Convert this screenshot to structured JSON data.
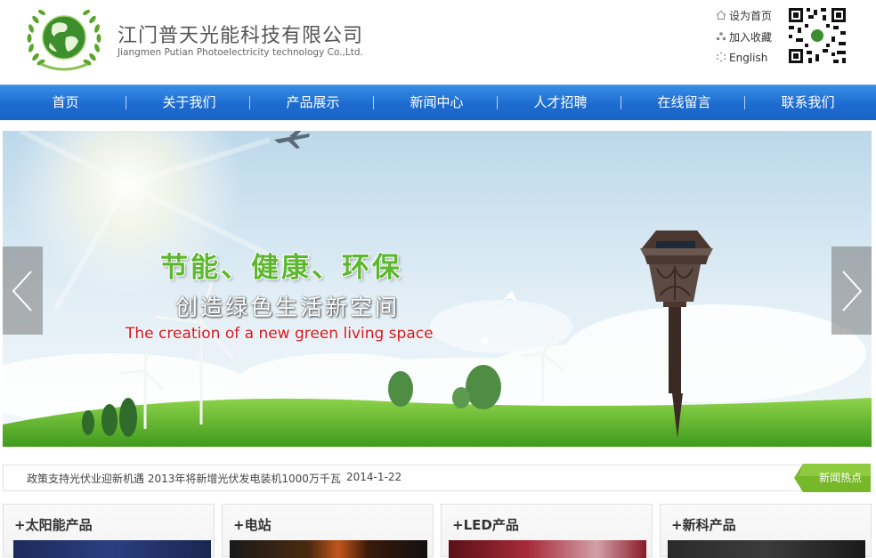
{
  "header": {
    "company_cn": "江门普天光能科技有限公司",
    "company_en": "Jiangmen  Putian Photoelectricity technology Co.,Ltd.",
    "quick_links": [
      {
        "label": "设为首页",
        "icon": "home-icon"
      },
      {
        "label": "加入收藏",
        "icon": "bookmark-icon"
      },
      {
        "label": "English",
        "icon": "globe-icon"
      }
    ]
  },
  "nav": {
    "items": [
      "首页",
      "关于我们",
      "产品展示",
      "新闻中心",
      "人才招聘",
      "在线留言",
      "联系我们"
    ]
  },
  "banner": {
    "slogan_cn": "节能、健康、环保",
    "slogan_cn2": "创造绿色生活新空间",
    "slogan_en": "The creation of a new green living space"
  },
  "news": {
    "headline": "政策支持光伏业迎新机遇 2013年将新增光伏发电装机1000万千瓦",
    "date": "2014-1-22",
    "tag": "新闻热点"
  },
  "products": [
    {
      "title": "+太阳能产品"
    },
    {
      "title": "+电站"
    },
    {
      "title": "+LED产品"
    },
    {
      "title": "+新科产品"
    }
  ],
  "colors": {
    "nav_blue": "#1d6bd0",
    "slogan_green": "#5cb82e",
    "slogan_red": "#d8141c",
    "news_tag_green": "#76b82a"
  }
}
